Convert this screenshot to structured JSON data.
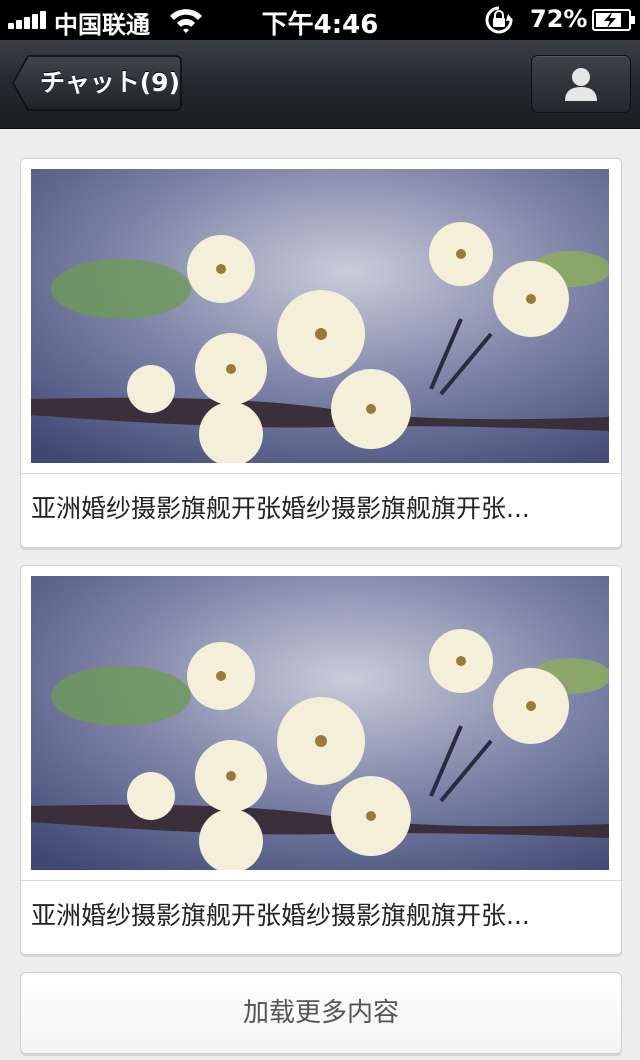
{
  "status_bar": {
    "carrier": "中国联通",
    "time": "下午4:46",
    "battery_percent": "72%",
    "icons": [
      "signal-icon",
      "wifi-icon",
      "rotation-lock-icon",
      "battery-charging-icon"
    ]
  },
  "nav_bar": {
    "back_label": "チャット(9)",
    "right_icon": "user-icon"
  },
  "feed": {
    "items": [
      {
        "title": "亚洲婚纱摄影旗舰开张婚纱摄影旗舰旗开张...",
        "image": "white-cherry-blossom-photo"
      },
      {
        "title": "亚洲婚纱摄影旗舰开张婚纱摄影旗舰旗开张...",
        "image": "white-cherry-blossom-photo"
      }
    ],
    "load_more_label": "加载更多内容"
  },
  "colors": {
    "nav_bar": "#23272b",
    "background": "#ededed",
    "card": "#ffffff"
  }
}
